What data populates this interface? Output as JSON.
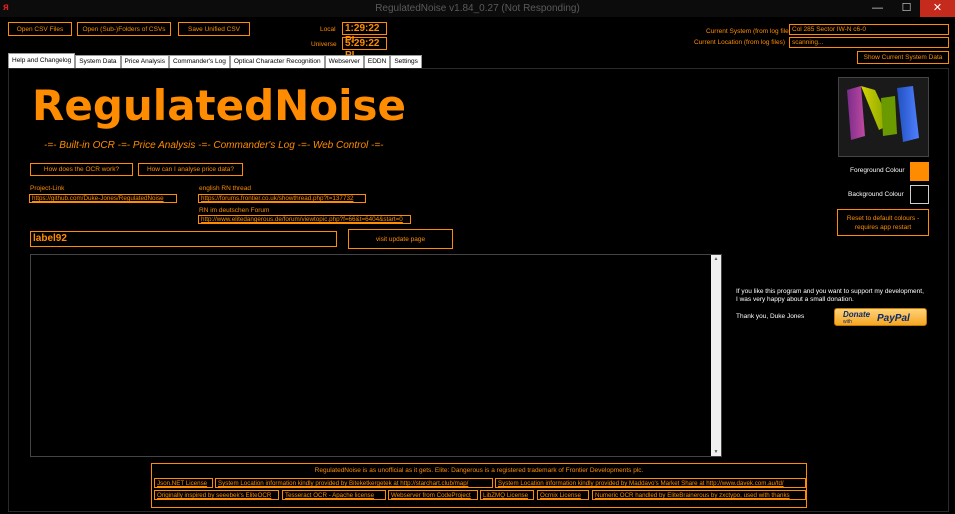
{
  "window": {
    "title": "RegulatedNoise v1.84_0.27 (Not Responding)",
    "minimize": "—",
    "maximize": "☐",
    "close": "✕",
    "close_color": "#c42b1c"
  },
  "toolbar": {
    "open_csv": "Open CSV Files",
    "open_sub": "Open (Sub-)Folders of CSVs",
    "save_unified": "Save Unified CSV"
  },
  "clocks": {
    "local_label": "Local",
    "local_value": "1:29:22 PI",
    "universe_label": "Universe",
    "universe_value": "5:29:22 PI"
  },
  "status": {
    "system_label": "Current System (from log files)",
    "system_value": "Col 285 Sector IW-N c6-0",
    "location_label": "Current Location (from log files)",
    "location_value": "scanning...",
    "show_system_button": "Show Current System Data"
  },
  "tabs": [
    {
      "label": "Help and Changelog",
      "active": true
    },
    {
      "label": "System Data",
      "active": false
    },
    {
      "label": "Price Analysis",
      "active": false
    },
    {
      "label": "Commander's Log",
      "active": false
    },
    {
      "label": "Optical Character Recognition",
      "active": false
    },
    {
      "label": "Webserver",
      "active": false
    },
    {
      "label": "EDDN",
      "active": false
    },
    {
      "label": "Settings",
      "active": false
    }
  ],
  "help": {
    "app_name": "RegulatedNoise",
    "tagline": "-=- Built-in OCR -=- Price Analysis -=- Commander's Log -=- Web Control -=-",
    "ocr_button": "How does the OCR work?",
    "price_button": "How can I analyse price data?",
    "project_link_label": "Project-Link",
    "project_link": "https://github.com/Duke-Jones/RegulatedNoise",
    "english_thread_label": "english RN thread",
    "english_thread_link": "https://forums.frontier.co.uk/showthread.php?t=137732",
    "german_thread_label": "RN im deutschen Forum",
    "german_thread_link": "http://www.elitedangerous.de/forum/viewtopic.php?f=66&t=6404&start=0",
    "version_label": "label92",
    "update_button": "visit update page",
    "donation_text_line1": "If you like this program and you want to support my development,",
    "donation_text_line2": "I was very happy about a small donation.",
    "thanks_text": "Thank you,  Duke Jones",
    "paypal_top": "Donate",
    "paypal_with": "with",
    "paypal_brand": "PayPal",
    "foreground_label": "Foreground Colour",
    "background_label": "Background Colour",
    "foreground_color": "#ff8c00",
    "background_color": "#000000",
    "reset_button_line1": "Reset to default colours -",
    "reset_button_line2": "requires app restart"
  },
  "footer": {
    "disclaimer": "RegulatedNoise is as unofficial as it gets.   Elite: Dangerous is a registered trademark of Frontier Developments plc.",
    "row1": [
      "Json.NET License",
      "System Location information kindly provided by Biteketkergetek at http://starchart.club/map/",
      "System Location information kindly provided by Maddavo's Market Share at http://www.davek.com.au/td/"
    ],
    "row2": [
      "Originally inspired by seeebek's EliteOCR",
      "Tesseract OCR - Apache license",
      "Webserver from CodeProject",
      "LibZMQ License",
      "Ocrnix License",
      "Numeric OCR handled by EliteBrainerous by zxctypo, used with thanks"
    ]
  },
  "colors": {
    "accent": "#ff8c00",
    "background": "#000000"
  }
}
